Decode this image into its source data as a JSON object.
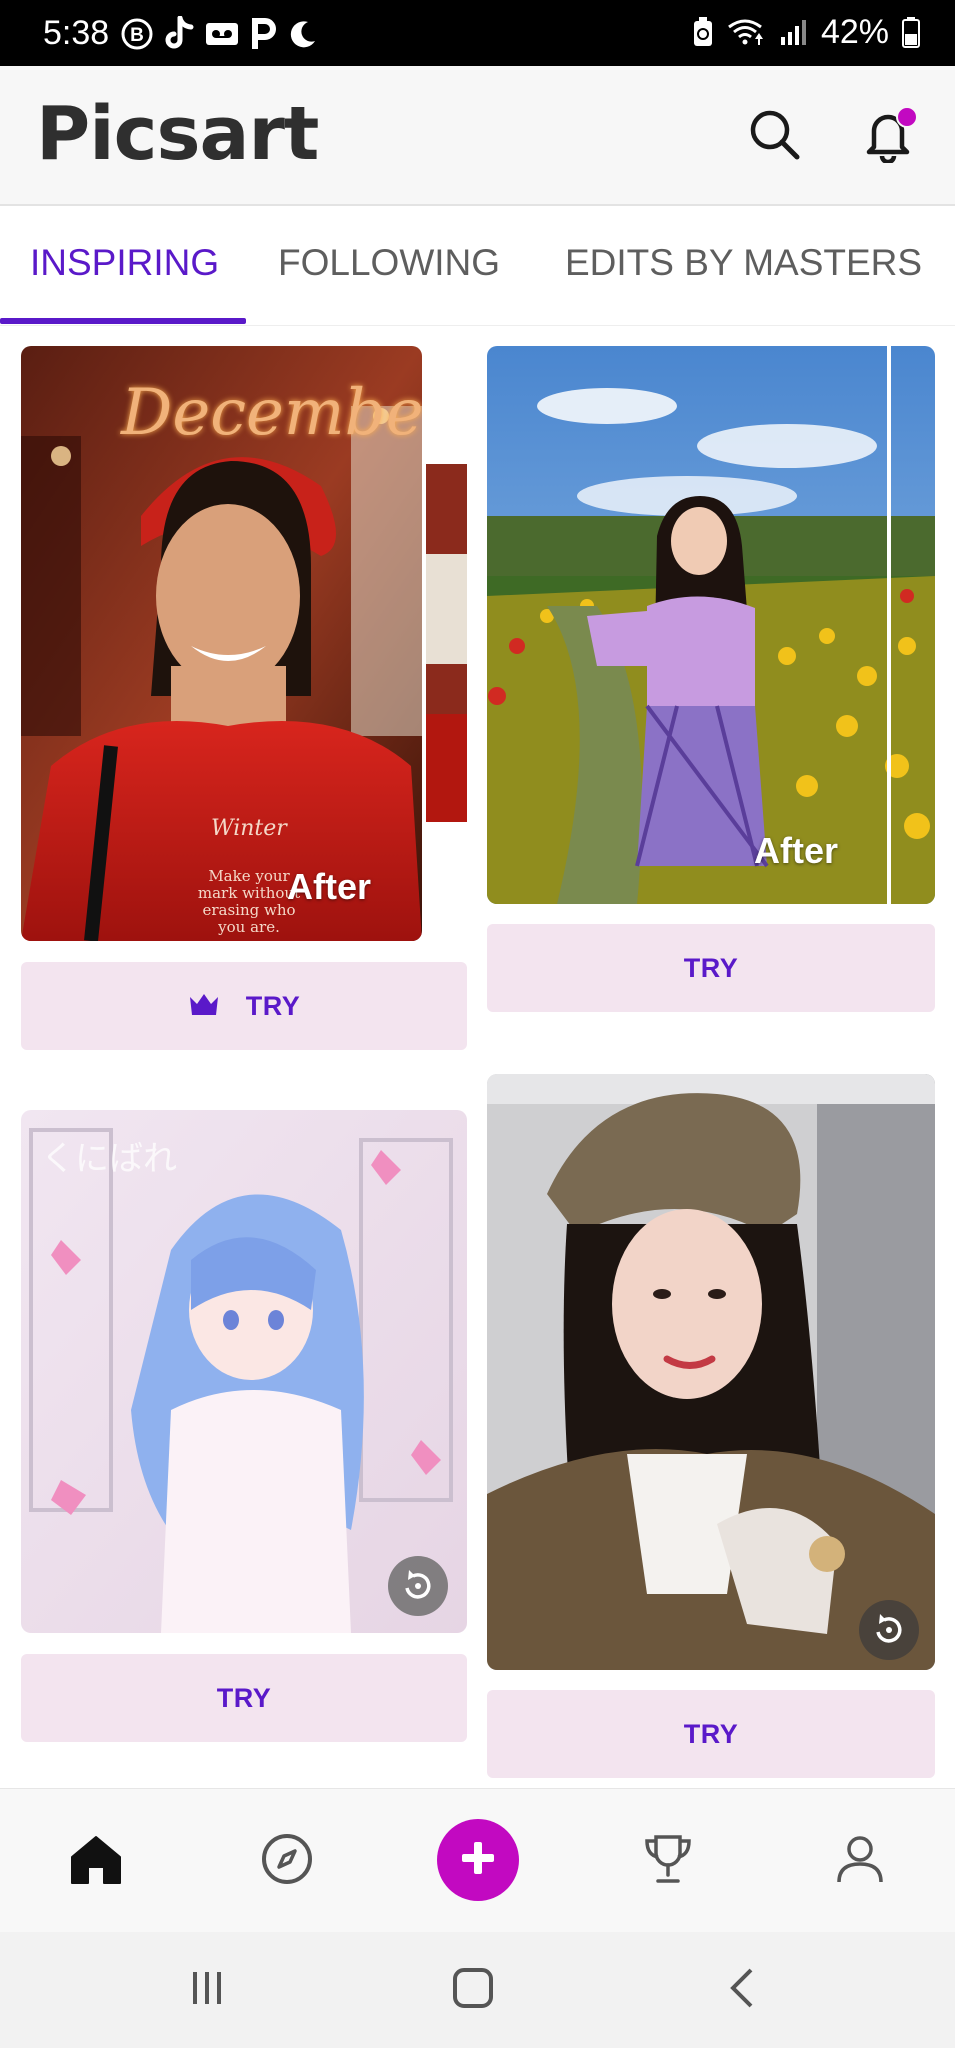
{
  "status_bar": {
    "time": "5:38",
    "battery": "42%",
    "icons_left": [
      "b-badge-icon",
      "tiktok-icon",
      "voicemail-icon",
      "p-icon",
      "moon-icon"
    ],
    "icons_right": [
      "recycle-icon",
      "wifi-icon",
      "signal-icon",
      "battery-icon"
    ]
  },
  "header": {
    "logo_text": "Picsart",
    "search_icon": "search-icon",
    "notification_icon": "bell-icon",
    "notification_dot_color": "#c209c1"
  },
  "tabs": [
    {
      "label": "INSPIRING",
      "active": true
    },
    {
      "label": "FOLLOWING",
      "active": false
    },
    {
      "label": "EDITS BY MASTERS",
      "active": false
    }
  ],
  "feed": {
    "cards": [
      {
        "overlay_text": "December",
        "caption_title": "Winter",
        "caption_body": "Make your mark without erasing who you are.",
        "after_label": "After",
        "try_label": "TRY",
        "premium": true
      },
      {
        "after_label": "After",
        "try_label": "TRY",
        "premium": false
      },
      {
        "try_label": "TRY",
        "replay_icon": "replay-icon"
      },
      {
        "try_label": "TRY",
        "replay_icon": "replay-icon"
      }
    ]
  },
  "bottom_nav": {
    "items": [
      "home-icon",
      "compass-icon",
      "plus-icon",
      "trophy-icon",
      "profile-icon"
    ],
    "accent": "#c209c1"
  },
  "system_nav": {
    "items": [
      "recents-icon",
      "home-button-icon",
      "back-icon"
    ]
  },
  "colors": {
    "accent": "#5a19c9",
    "create": "#c209c1",
    "try_bg": "#f3e4ef"
  }
}
